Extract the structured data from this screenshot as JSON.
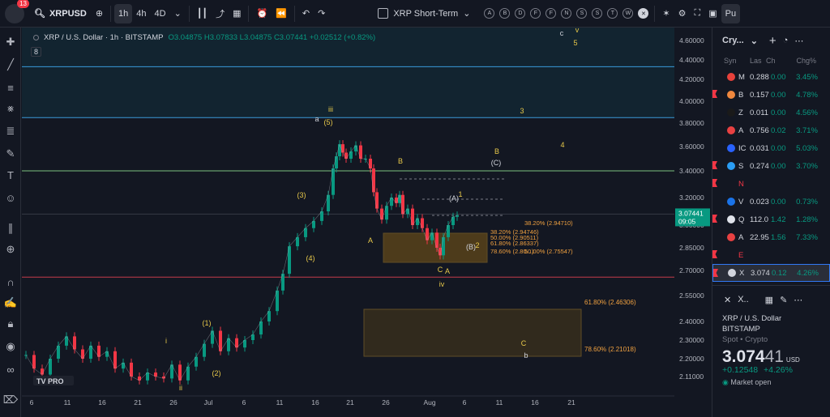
{
  "topbar": {
    "notif_count": "13",
    "symbol": "XRPUSD",
    "intervals": [
      "1h",
      "4h",
      "4D"
    ],
    "active_interval": "1h",
    "layout_name": "XRP Short-Term",
    "drawing_letters": [
      "A",
      "B",
      "D",
      "F",
      "F",
      "N",
      "S",
      "S",
      "T",
      "W"
    ],
    "publish_label": "Pu"
  },
  "legend": {
    "title": "XRP / U.S. Dollar · 1h · BITSTAMP",
    "ohlc": "O3.04875  H3.07833  L3.04875  C3.07441  +0.02512 (+0.82%)",
    "indicators": "8"
  },
  "chart_data": {
    "type": "candlestick",
    "symbol": "XRPUSD",
    "ylim": [
      2.07,
      4.7
    ],
    "y_ticks": [
      "4.60000",
      "4.40000",
      "4.20000",
      "4.00000",
      "3.80000",
      "3.60000",
      "3.40000",
      "3.20000",
      "3.00000",
      "2.85000",
      "2.70000",
      "2.55000",
      "2.40000",
      "2.30000",
      "2.20000",
      "2.11000"
    ],
    "x_ticks": [
      "6",
      "11",
      "16",
      "21",
      "26",
      "Jul",
      "6",
      "11",
      "16",
      "21",
      "26",
      "Aug",
      "6",
      "11",
      "16",
      "21"
    ],
    "last_price": "3.07441",
    "last_time": "09:05",
    "hlines": [
      {
        "value": 4.33,
        "color": "#3a9ad9"
      },
      {
        "value": 3.85,
        "color": "#3a9ad9"
      },
      {
        "value": 3.4,
        "color": "#7bc17e"
      },
      {
        "value": 3.08,
        "color": "#363a45"
      },
      {
        "value": 2.66,
        "color": "#c53b4a"
      }
    ],
    "fib_top": [
      {
        "label": "38.20% (2.94710)"
      },
      {
        "label": "38.20% (2.94746)"
      },
      {
        "label": "50.00% (2.90511)"
      },
      {
        "label": "61.80% (2.86337)"
      },
      {
        "label": "78.60% (2.80...)"
      },
      {
        "label": "50.00% (2.75547)"
      }
    ],
    "fib_bottom": [
      {
        "label": "61.80% (2.46306)"
      },
      {
        "label": "78.60% (2.21018)"
      }
    ],
    "wave_labels": [
      "i",
      "ii",
      "(1)",
      "(2)",
      "(3)",
      "(4)",
      "(5)",
      "iii",
      "a",
      "c",
      "v",
      "5",
      "3",
      "4",
      "B",
      "A",
      "C",
      "(A)",
      "(B)",
      "(C)",
      "B",
      "1",
      "2",
      "iv",
      "A",
      "C",
      "b"
    ]
  },
  "watchlist": {
    "title": "Cry...",
    "columns": [
      "Syn",
      "Las",
      "Ch",
      "Chg%"
    ],
    "rows": [
      {
        "sym": "M",
        "last": "0.288",
        "chg": "0.00",
        "pct": "3.45%",
        "color": "#e8413b",
        "flag": false
      },
      {
        "sym": "B",
        "last": "0.157",
        "chg": "0.00",
        "pct": "4.78%",
        "color": "#f0883e",
        "flag": true
      },
      {
        "sym": "Z",
        "last": "0.011",
        "chg": "0.00",
        "pct": "4.56%",
        "color": "#1a1a1a",
        "flag": false
      },
      {
        "sym": "A",
        "last": "0.756",
        "chg": "0.02",
        "pct": "3.71%",
        "color": "#e84142",
        "flag": false
      },
      {
        "sym": "IC",
        "last": "0.031",
        "chg": "0.00",
        "pct": "5.03%",
        "color": "#2962ff",
        "flag": false
      },
      {
        "sym": "S",
        "last": "0.274",
        "chg": "0.00",
        "pct": "3.70%",
        "color": "#2a9df4",
        "flag": true
      },
      {
        "sym": "N",
        "last": "",
        "chg": "",
        "pct": "",
        "color": "",
        "flag": true
      },
      {
        "sym": "V",
        "last": "0.023",
        "chg": "0.00",
        "pct": "0.73%",
        "color": "#1a73e8",
        "flag": false
      },
      {
        "sym": "Q",
        "last": "112.0",
        "chg": "1.42",
        "pct": "1.28%",
        "color": "#e0e3eb",
        "flag": true
      },
      {
        "sym": "A",
        "last": "22.95",
        "chg": "1.56",
        "pct": "7.33%",
        "color": "#e84142",
        "flag": false
      },
      {
        "sym": "E",
        "last": "",
        "chg": "",
        "pct": "",
        "color": "",
        "flag": true
      },
      {
        "sym": "X",
        "last": "3.074",
        "chg": "0.12",
        "pct": "4.26%",
        "color": "#d1d4dc",
        "flag": true,
        "selected": true
      }
    ]
  },
  "detail": {
    "short": "X..",
    "name": "XRP / U.S. Dollar",
    "exchange": "BITSTAMP",
    "category": "Spot • Crypto",
    "price_main": "3.074",
    "price_small": "41",
    "currency": "USD",
    "change": "+0.12548",
    "change_pct": "+4.26%",
    "market_status": "Market open"
  }
}
